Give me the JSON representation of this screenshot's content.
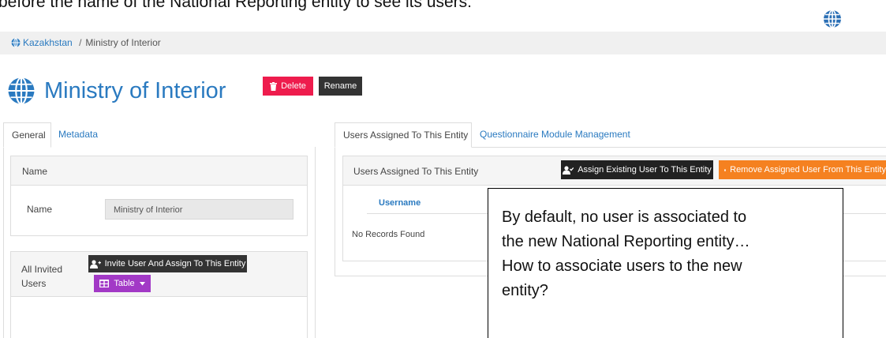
{
  "doc": {
    "top_text": "before the name of the National Reporting entity to see its users:"
  },
  "icons": {
    "globe": "globe-icon",
    "trash": "trash-icon",
    "user_plus": "user-plus-icon",
    "user_check": "user-check-icon",
    "minus_square": "minus-square-icon",
    "table": "table-icon",
    "caret": "caret-down-icon"
  },
  "colors": {
    "link": "#2a7ac0",
    "delete": "#ee1c4d",
    "dark": "#333333",
    "orange": "#f58120",
    "purple": "#a239c6"
  },
  "breadcrumb": {
    "parent": "Kazakhstan",
    "separator": "/",
    "current": "Ministry of Interior"
  },
  "page": {
    "title": "Ministry of Interior",
    "delete_label": "Delete",
    "rename_label": "Rename"
  },
  "left_tabs": [
    {
      "label": "General"
    },
    {
      "label": "Metadata"
    }
  ],
  "general": {
    "name_section_title": "Name",
    "name_label": "Name",
    "name_value": "Ministry of Interior",
    "invited_label_line1": "All Invited",
    "invited_label_line2": "Users",
    "invite_button": "Invite User And Assign To This Entity",
    "table_button": "Table"
  },
  "right_tabs": [
    {
      "label": "Users Assigned To This Entity"
    },
    {
      "label": "Questionnaire Module Management"
    }
  ],
  "users": {
    "section_title": "Users Assigned To This Entity",
    "assign_button": "Assign Existing User To This Entity",
    "remove_button": "Remove Assigned User From This Entity",
    "column_username": "Username",
    "empty_text": "No Records Found"
  },
  "callout": {
    "lines": [
      "By default, no user is associated to",
      "the new National Reporting entity…",
      "How to associate users to the new",
      "entity?"
    ]
  }
}
